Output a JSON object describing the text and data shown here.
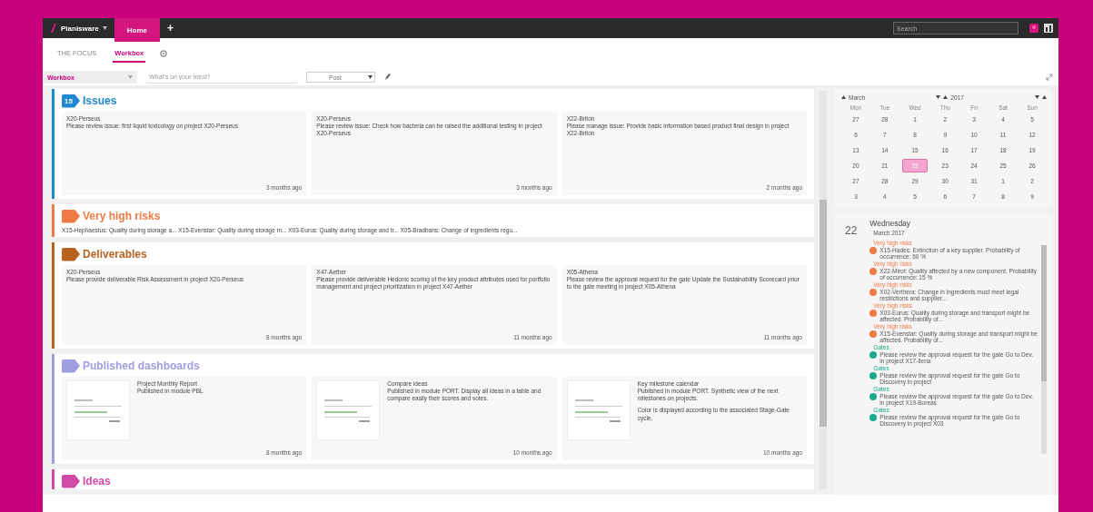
{
  "topbar": {
    "app_menu": "Planisware",
    "home_tab": "Home",
    "add_tab": "+",
    "search": {
      "placeholder": "Search"
    }
  },
  "tabs": [
    {
      "label": "THE FOCUS",
      "selected": false
    },
    {
      "label": "Workbox",
      "selected": true
    }
  ],
  "filter": {
    "workbox": "Workbox",
    "post_field": {
      "placeholder": "What's on your mind?"
    },
    "post_type": "Post"
  },
  "sections": [
    {
      "kind": "cards",
      "title": "Issues",
      "count": "15",
      "color": "#1e88d0",
      "cards": [
        {
          "project": "X20-Perseus",
          "text": "Please review issue: first liquid toxicology on project X20-Perseus",
          "age": "3 months ago"
        },
        {
          "project": "X20-Perseus",
          "text": "Please review issue: Check how bacteria can be raised the additional testing in project X20-Perseus",
          "age": "3 months ago"
        },
        {
          "project": "X22-Briton",
          "text": "Please manage issue: Provide basic information based product final design in project X22-Briton",
          "age": "2 months ago"
        }
      ]
    },
    {
      "kind": "summary",
      "title": "Very high risks",
      "color": "#f07a45",
      "text": "X15-Hephaestus: Quality during storage a... X15-Evenstar: Quality during storage m... X03-Eurus: Quality during storage and tr... X05-Bradbans: Change of ingredients regu..."
    },
    {
      "kind": "cards",
      "title": "Deliverables",
      "color": "#b8621f",
      "cards": [
        {
          "project": "X20-Perseus",
          "text": "Please provide deliverable Risk Assessment in project X20-Perseus",
          "age": "8 months ago"
        },
        {
          "project": "X47-Aether",
          "text": "Please provide deliverable Hedonic scoring of the key product attributes used for portfolio management and project prioritization in project X47-Aether",
          "age": "11 months ago"
        },
        {
          "project": "X05-Athena",
          "text": "Please review the approval request for the gate Update the Sustainability Scorecard prior to the gate meeting in project X05-Athena",
          "age": "11 months ago"
        }
      ]
    },
    {
      "kind": "dashboards",
      "title": "Published dashboards",
      "color": "#a09ee0",
      "cards": [
        {
          "title": "Project Monthly Report",
          "text": "Published in module PBL",
          "age": "8 months ago"
        },
        {
          "title": "Compare ideas",
          "text": "Published in module PORT. Display all ideas in a table and compare easily their scores and votes.",
          "age": "10 months ago"
        },
        {
          "title": "Key milestone calendar",
          "text": "Published in module PORT. Synthetic view of the next milestones on projects.",
          "note": "Color is displayed according to the associated Stage-Gate cycle.",
          "age": "10 months ago"
        }
      ]
    },
    {
      "kind": "header",
      "title": "Ideas",
      "color": "#d24aa8"
    }
  ],
  "calendar": {
    "month": "March",
    "year": "2017",
    "weekdays": [
      "Mon",
      "Tue",
      "Wed",
      "Thu",
      "Fri",
      "Sat",
      "Sun"
    ],
    "weeks": [
      [
        {
          "label": "27",
          "selected": false
        },
        {
          "label": "28",
          "selected": false
        },
        {
          "label": "1",
          "selected": false
        },
        {
          "label": "2",
          "selected": false
        },
        {
          "label": "3",
          "selected": false
        },
        {
          "label": "4",
          "selected": false
        },
        {
          "label": "5",
          "selected": false
        }
      ],
      [
        {
          "label": "6",
          "selected": false
        },
        {
          "label": "7",
          "selected": false
        },
        {
          "label": "8",
          "selected": false
        },
        {
          "label": "9",
          "selected": false
        },
        {
          "label": "10",
          "selected": false
        },
        {
          "label": "11",
          "selected": false
        },
        {
          "label": "12",
          "selected": false
        }
      ],
      [
        {
          "label": "13",
          "selected": false
        },
        {
          "label": "14",
          "selected": false
        },
        {
          "label": "15",
          "selected": false
        },
        {
          "label": "16",
          "selected": false
        },
        {
          "label": "17",
          "selected": false
        },
        {
          "label": "18",
          "selected": false
        },
        {
          "label": "19",
          "selected": false
        }
      ],
      [
        {
          "label": "20",
          "selected": false
        },
        {
          "label": "21",
          "selected": false
        },
        {
          "label": "22",
          "selected": true
        },
        {
          "label": "23",
          "selected": false
        },
        {
          "label": "24",
          "selected": false
        },
        {
          "label": "25",
          "selected": false
        },
        {
          "label": "26",
          "selected": false
        }
      ],
      [
        {
          "label": "27",
          "selected": false
        },
        {
          "label": "28",
          "selected": false
        },
        {
          "label": "29",
          "selected": false
        },
        {
          "label": "30",
          "selected": false
        },
        {
          "label": "31",
          "selected": false
        },
        {
          "label": "1",
          "selected": false
        },
        {
          "label": "2",
          "selected": false
        }
      ],
      [
        {
          "label": "3",
          "selected": false
        },
        {
          "label": "4",
          "selected": false
        },
        {
          "label": "5",
          "selected": false
        },
        {
          "label": "6",
          "selected": false
        },
        {
          "label": "7",
          "selected": false
        },
        {
          "label": "8",
          "selected": false
        },
        {
          "label": "9",
          "selected": false
        }
      ]
    ]
  },
  "agenda": {
    "day": "22",
    "weekday": "Wednesday",
    "month": "March 2017",
    "items": [
      {
        "category": "Very high risks",
        "color": "#f07a45",
        "text": "X15-Hades: Extinction of a key supplier. Probability of occurrence: 60 %"
      },
      {
        "category": "Very high risks",
        "color": "#f07a45",
        "text": "X22-Mirot: Quality affected by a new component. Probability of occurrence: 15 %"
      },
      {
        "category": "Very high risks",
        "color": "#f07a45",
        "text": "X02-Verthera: Change in ingredients must meet legal restrictions and supplier..."
      },
      {
        "category": "Very high risks",
        "color": "#f07a45",
        "text": "X03-Eurus: Quality during storage and transport might be affected. Probability of..."
      },
      {
        "category": "Very high risks",
        "color": "#f07a45",
        "text": "X15-Evenstar: Quality during storage and transport might be affected. Probability of..."
      },
      {
        "category": "Gates",
        "color": "#1aaa8a",
        "text": "Please review the approval request for the gate Go to Dev. in project X17-Ilena"
      },
      {
        "category": "Gates",
        "color": "#1aaa8a",
        "text": "Please review the approval request for the gate Go to Discovery in project"
      },
      {
        "category": "Gates",
        "color": "#1aaa8a",
        "text": "Please review the approval request for the gate Go to Dev. in project X19-Boreas"
      },
      {
        "category": "Gates",
        "color": "#1aaa8a",
        "text": "Please review the approval request for the gate Go to Discovery in project X03"
      }
    ]
  }
}
